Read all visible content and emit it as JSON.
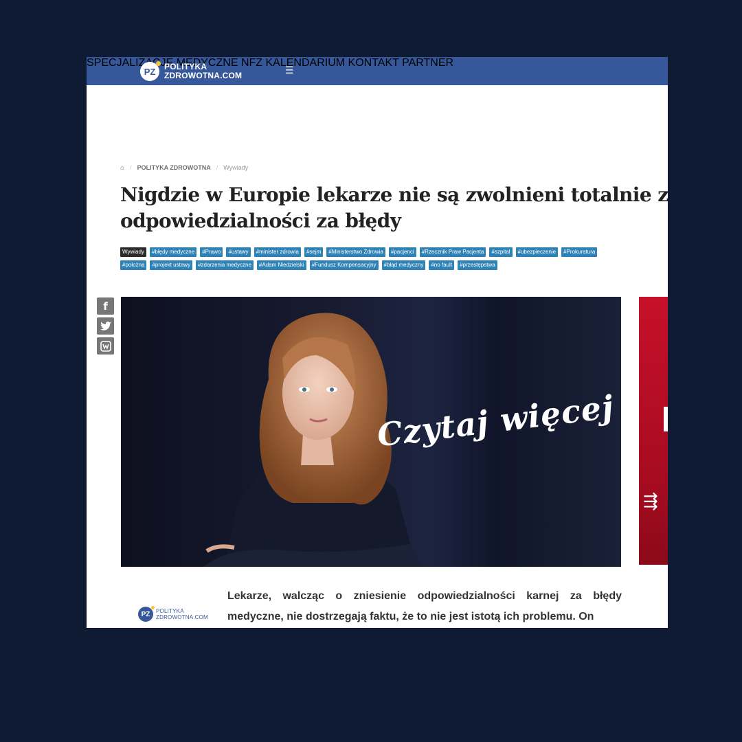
{
  "header": {
    "logo": {
      "badge": "PZ",
      "line1": "POLITYKA",
      "line2": "ZDROWOTNA.COM"
    },
    "menu_icon": "hamburger-icon",
    "nav": [
      "SPECJALIZACJE MEDYCZNE",
      "NFZ",
      "KALENDARIUM",
      "KONTAKT",
      "PARTNER"
    ]
  },
  "breadcrumb": {
    "home_icon": "home-icon",
    "section": "POLITYKA ZDROWOTNA",
    "current": "Wywiady"
  },
  "article": {
    "title": "Nigdzie w Europie lekarze nie są zwolnieni totalnie z odpowiedzialności za błędy",
    "tags": [
      "Wywiady",
      "#błędy medyczne",
      "#Prawo",
      "#ustawy",
      "#minister zdrowia",
      "#sejm",
      "#Ministerstwo Zdrowia",
      "#pacjenci",
      "#Rzecznik Praw Pacjenta",
      "#szpital",
      "#ubezpieczenie",
      "#Prokuratura",
      "#położna",
      "#projekt ustawy",
      "#zdarzenia medyczne",
      "#Adam Niedzielski",
      "#Fundusz Kompensacyjny",
      "#błąd medyczny",
      "#no fault",
      "#przestępstwa"
    ],
    "hero_caption": "Czytaj więcej",
    "lead": "Lekarze, walcząc o zniesienie odpowiedzialności karnej za błędy medyczne, nie dostrzegają faktu, że to nie jest istotą ich problemu. On"
  },
  "share": [
    "facebook-icon",
    "twitter-icon",
    "wykop-icon"
  ],
  "footer_logo": {
    "badge": "PZ",
    "line1": "POLITYKA",
    "line2": "ZDROWOTNA.COM"
  },
  "colors": {
    "header_bg": "#36589a",
    "tag_bg": "#2e82b6",
    "page_bg": "#0f1a33",
    "ad_red": "#c7102a"
  }
}
